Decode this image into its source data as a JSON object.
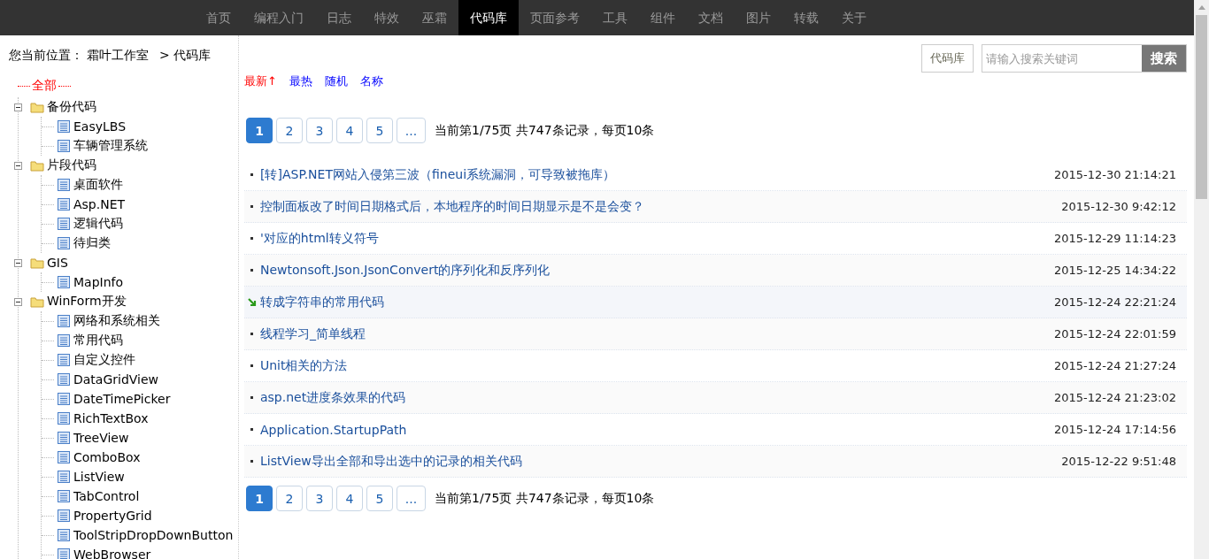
{
  "nav": {
    "items": [
      {
        "label": "首页",
        "selected": false
      },
      {
        "label": "编程入门",
        "selected": false
      },
      {
        "label": "日志",
        "selected": false
      },
      {
        "label": "特效",
        "selected": false
      },
      {
        "label": "巫霜",
        "selected": false
      },
      {
        "label": "代码库",
        "selected": true
      },
      {
        "label": "页面参考",
        "selected": false
      },
      {
        "label": "工具",
        "selected": false
      },
      {
        "label": "组件",
        "selected": false
      },
      {
        "label": "文档",
        "selected": false
      },
      {
        "label": "图片",
        "selected": false
      },
      {
        "label": "转载",
        "selected": false
      },
      {
        "label": "关于",
        "selected": false
      }
    ]
  },
  "breadcrumb": {
    "prefix": "您当前位置：",
    "site": "霜叶工作室",
    "separator": ">",
    "current": "代码库"
  },
  "search": {
    "scope": "代码库",
    "placeholder": "请输入搜索关键词",
    "button": "搜索"
  },
  "sidebar": {
    "all": "全部",
    "items": [
      {
        "label": "备份代码",
        "expanded": true,
        "children": [
          {
            "label": "EasyLBS"
          },
          {
            "label": "车辆管理系统"
          }
        ]
      },
      {
        "label": "片段代码",
        "expanded": true,
        "children": [
          {
            "label": "桌面软件"
          },
          {
            "label": "Asp.NET"
          },
          {
            "label": "逻辑代码"
          },
          {
            "label": "待归类"
          }
        ]
      },
      {
        "label": "GIS",
        "expanded": true,
        "children": [
          {
            "label": "MapInfo"
          }
        ]
      },
      {
        "label": "WinForm开发",
        "expanded": true,
        "children": [
          {
            "label": "网络和系统相关"
          },
          {
            "label": "常用代码"
          },
          {
            "label": "自定义控件"
          },
          {
            "label": "DataGridView"
          },
          {
            "label": "DateTimePicker"
          },
          {
            "label": "RichTextBox"
          },
          {
            "label": "TreeView"
          },
          {
            "label": "ComboBox"
          },
          {
            "label": "ListView"
          },
          {
            "label": "TabControl"
          },
          {
            "label": "PropertyGrid"
          },
          {
            "label": "ToolStripDropDownButton"
          },
          {
            "label": "WebBrowser"
          }
        ]
      }
    ]
  },
  "sort": [
    {
      "label": "最新↑",
      "selected": true
    },
    {
      "label": "最热",
      "selected": false
    },
    {
      "label": "随机",
      "selected": false
    },
    {
      "label": "名称",
      "selected": false
    }
  ],
  "pagination_top": {
    "pages": [
      {
        "label": "1",
        "selected": true
      },
      {
        "label": "2",
        "selected": false
      },
      {
        "label": "3",
        "selected": false
      },
      {
        "label": "4",
        "selected": false
      },
      {
        "label": "5",
        "selected": false
      },
      {
        "label": "...",
        "selected": false
      }
    ],
    "summary": "当前第1/75页 共747条记录，每页10条"
  },
  "articles": [
    {
      "title": "[转]ASP.NET网站入侵第三波（fineui系统漏洞，可导致被拖库）",
      "time": "2015-12-30 21:14:21",
      "hovered": false
    },
    {
      "title": "控制面板改了时间日期格式后，本地程序的时间日期显示是不是会变？",
      "time": "2015-12-30 9:42:12",
      "hovered": false
    },
    {
      "title": "'对应的html转义符号",
      "time": "2015-12-29 11:14:23",
      "hovered": false
    },
    {
      "title": "Newtonsoft.Json.JsonConvert的序列化和反序列化",
      "time": "2015-12-25 14:34:22",
      "hovered": false
    },
    {
      "title": "转成字符串的常用代码",
      "time": "2015-12-24 22:21:24",
      "hovered": true
    },
    {
      "title": "线程学习_简单线程",
      "time": "2015-12-24 22:01:59",
      "hovered": false
    },
    {
      "title": "Unit相关的方法",
      "time": "2015-12-24 21:27:24",
      "hovered": false
    },
    {
      "title": "asp.net进度条效果的代码",
      "time": "2015-12-24 21:23:02",
      "hovered": false
    },
    {
      "title": "Application.StartupPath",
      "time": "2015-12-24 17:14:56",
      "hovered": false
    },
    {
      "title": "ListView导出全部和导出选中的记录的相关代码",
      "time": "2015-12-22 9:51:48",
      "hovered": false
    }
  ],
  "pagination_bottom": {
    "pages": [
      {
        "label": "1",
        "selected": true
      },
      {
        "label": "2",
        "selected": false
      },
      {
        "label": "3",
        "selected": false
      },
      {
        "label": "4",
        "selected": false
      },
      {
        "label": "5",
        "selected": false
      },
      {
        "label": "...",
        "selected": false
      }
    ],
    "summary": "当前第1/75页 共747条记录，每页10条"
  }
}
